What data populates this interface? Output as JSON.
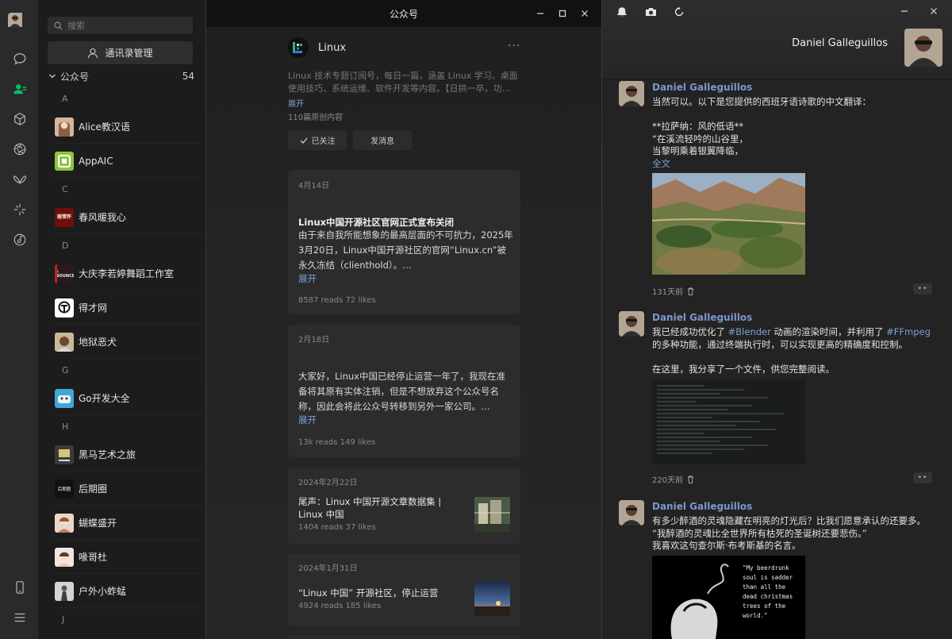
{
  "rail": {
    "icons": [
      "chat-icon",
      "contacts-icon",
      "box-icon",
      "aperture-icon",
      "butterfly-icon",
      "sparkle-icon",
      "music-icon",
      "phone-icon",
      "menu-icon"
    ]
  },
  "contacts": {
    "search_placeholder": "搜索",
    "manage_label": "通讯录管理",
    "group_label": "公众号",
    "group_count": "54",
    "letters": [
      "A",
      "C",
      "D",
      "G",
      "H",
      "J"
    ],
    "items": [
      {
        "name": "Alice教汉语"
      },
      {
        "name": "AppAIC"
      },
      {
        "name": "春风暖我心"
      },
      {
        "name": "大庆李若婷舞蹈工作室"
      },
      {
        "name": "得才网"
      },
      {
        "name": "地狱恶犬"
      },
      {
        "name": "Go开发大全"
      },
      {
        "name": "黑马艺术之旅"
      },
      {
        "name": "后期圈"
      },
      {
        "name": "蝴蝶盛开"
      },
      {
        "name": "喙哥杜"
      },
      {
        "name": "户外小蚱蜢"
      }
    ],
    "logo_texts": {
      "chunfeng": "暖情怀",
      "daqing": "L BOUNCE",
      "houqi": "后期圈"
    }
  },
  "official": {
    "window_title": "公众号",
    "name": "Linux",
    "description": "Linux 技术专题订阅号，每日一篇，涵盖 Linux 学习、桌面使用技巧、系统运维、软件开发等内容。【日拱一卒，功…",
    "expand": "展开",
    "article_count": "110篇原创内容",
    "followed_label": "已关注",
    "message_label": "发消息",
    "cards": [
      {
        "date": "4月14日",
        "title": "Linux中国开源社区官网正式宣布关闭",
        "body": "由于来自我所能想象的最高层面的不可抗力，2025年3月20日，Linux中国开源社区的官网“Linux.cn”被永久冻结（clienthold）。…",
        "more": "展开",
        "stats": "8587 reads   72 likes"
      },
      {
        "date": "2月18日",
        "body": "大家好，Linux中国已经停止运营一年了，我现在准备将其原有实体注销，但是不想放弃这个公众号名称，因此会将此公众号转移到另外一家公司。…",
        "more": "展开",
        "stats": "13k reads   149 likes"
      },
      {
        "date": "2024年2月22日",
        "title": "尾声：Linux 中国开源文章数据集 | Linux 中国",
        "stats": "1404 reads   37 likes"
      },
      {
        "date": "2024年1月31日",
        "title": "“Linux 中国” 开源社区，停止运营",
        "stats": "4924 reads   185 likes"
      }
    ]
  },
  "moments": {
    "user_name": "Daniel Galleguillos",
    "posts": [
      {
        "author": "Daniel Galleguillos",
        "text": "当然可以。以下是您提供的西班牙语诗歌的中文翻译：\n\n**拉萨纳：风的低语**\n“在溪流轻吟的山谷里，\n当黎明乘着银翼降临，",
        "full": "全文",
        "time": "131天前"
      },
      {
        "author": "Daniel Galleguillos",
        "text_before": "我已经成功优化了 ",
        "tag1": "#Blender",
        "text_mid": " 动画的渲染时间，并利用了 ",
        "tag2": "#FFmpeg",
        "text_after": " 的多种功能，通过终端执行时，可以实现更高的精确度和控制。\n\n在这里，我分享了一个文件，供您完整阅读。",
        "time": "220天前"
      },
      {
        "author": "Daniel Galleguillos",
        "text": "有多少醉酒的灵魂隐藏在明亮的灯光后？比我们愿意承认的还要多。\n“我醉酒的灵魂比全世界所有枯死的圣诞树还要悲伤。”\n我喜欢这句查尔斯·布考斯基的名言。",
        "quote_image_text": "\"My beerdrunk\nsoul is sadder\nthan all the\ndead christmas\ntrees of the\nworld.\""
      }
    ]
  }
}
